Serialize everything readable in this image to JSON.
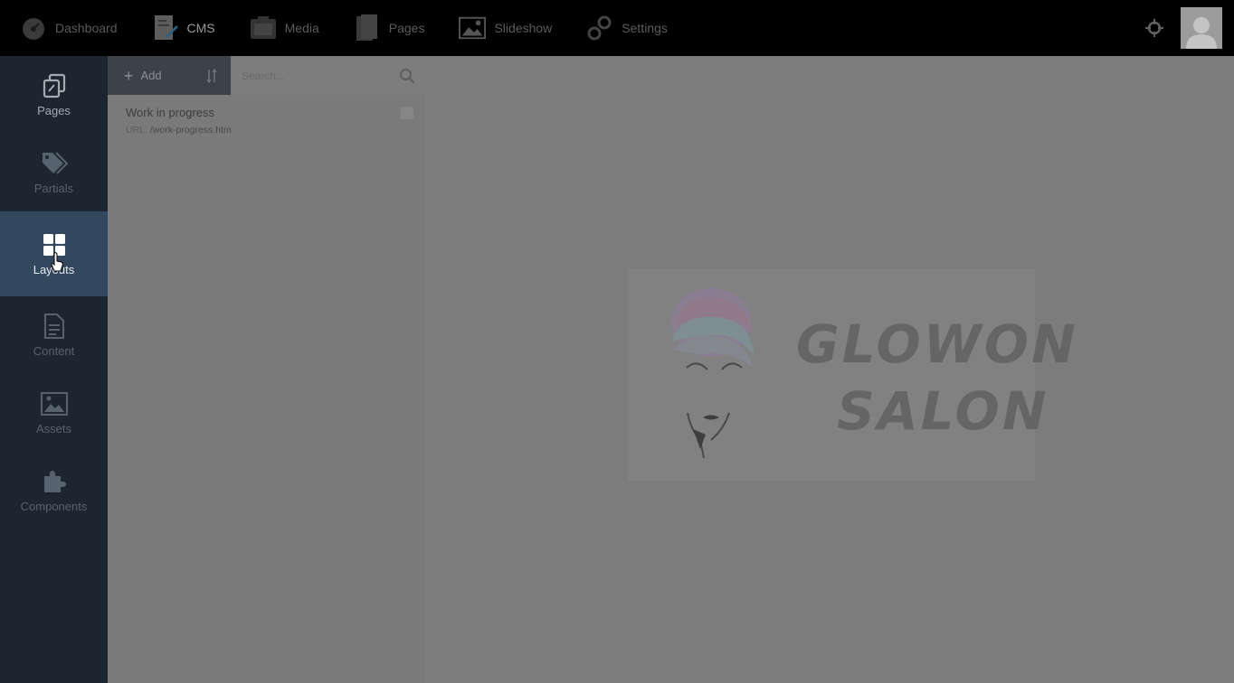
{
  "topbar": {
    "items": [
      {
        "label": "Dashboard",
        "icon": "dashboard-gauge-icon"
      },
      {
        "label": "CMS",
        "icon": "cms-icon"
      },
      {
        "label": "Media",
        "icon": "media-icon"
      },
      {
        "label": "Pages",
        "icon": "pages-icon"
      },
      {
        "label": "Slideshow",
        "icon": "slideshow-image-icon"
      },
      {
        "label": "Settings",
        "icon": "settings-gears-icon"
      }
    ]
  },
  "sidebar": {
    "items": [
      {
        "label": "Pages",
        "icon": "pages-copy-icon"
      },
      {
        "label": "Partials",
        "icon": "tags-icon"
      },
      {
        "label": "Layouts",
        "icon": "layouts-grid-icon"
      },
      {
        "label": "Content",
        "icon": "document-icon"
      },
      {
        "label": "Assets",
        "icon": "image-icon"
      },
      {
        "label": "Components",
        "icon": "puzzle-icon"
      }
    ],
    "active": "Layouts"
  },
  "panel": {
    "add_label": "Add",
    "search_placeholder": "Search...",
    "items": [
      {
        "title": "Work in progress",
        "url_label": "URL:",
        "url": "/work-progress.htm"
      }
    ]
  },
  "preview": {
    "brand_line1": "GLOWON",
    "brand_line2": "SALON"
  },
  "colors": {
    "topbar": "#000000",
    "sidebar": "#1d2530",
    "sidebar_active": "#33485e",
    "overlay_bg": "#7c7c7c"
  }
}
